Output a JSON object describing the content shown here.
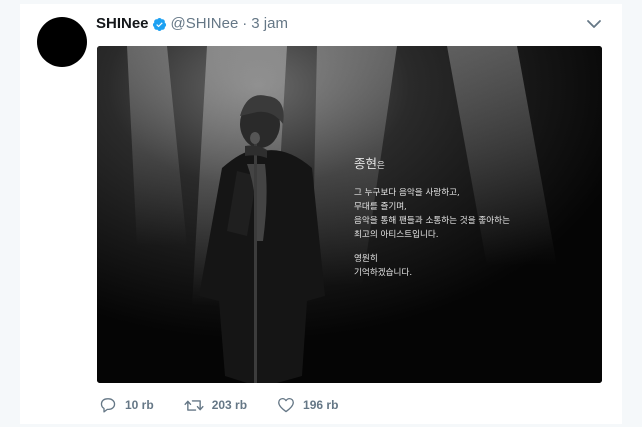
{
  "tweet": {
    "display_name": "SHINee",
    "handle": "@SHINee",
    "separator": "·",
    "time": "3 jam",
    "media": {
      "heading": "종현",
      "heading_suffix": "은",
      "lines": [
        "그 누구보다 음악을 사랑하고,",
        "무대를 즐기며,",
        "음악을 통해 팬들과 소통하는 것을 좋아하는",
        "최고의 아티스트입니다."
      ],
      "closing": [
        "영원히",
        "기억하겠습니다."
      ]
    },
    "actions": {
      "replies": "10 rb",
      "retweets": "203 rb",
      "likes": "196 rb"
    }
  },
  "colors": {
    "verified": "#1da1f2",
    "muted_text": "#657786",
    "name_text": "#14171a",
    "page_background": "#f5f8fa"
  },
  "icons": {
    "verified": "verified-badge-icon",
    "caret": "chevron-down-icon",
    "reply": "reply-icon",
    "retweet": "retweet-icon",
    "like": "heart-icon"
  }
}
